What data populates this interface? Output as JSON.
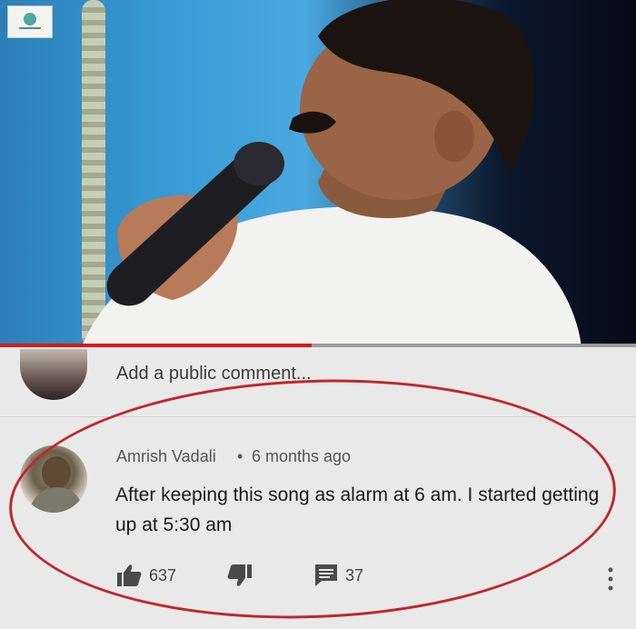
{
  "video": {
    "progress_fraction": 0.49,
    "accent_color": "#d71b1b"
  },
  "comment_box": {
    "placeholder": "Add a public comment..."
  },
  "comment": {
    "author": "Amrish Vadali",
    "separator": "•",
    "time": "6 months ago",
    "text": "After keeping this song as alarm at 6 am. I started getting up at 5:30 am",
    "likes": "637",
    "replies": "37"
  },
  "icons": {
    "like": "thumbs-up-icon",
    "dislike": "thumbs-down-icon",
    "reply": "reply-icon",
    "menu": "more-vertical-icon"
  },
  "annotation_color": "#c1272d"
}
